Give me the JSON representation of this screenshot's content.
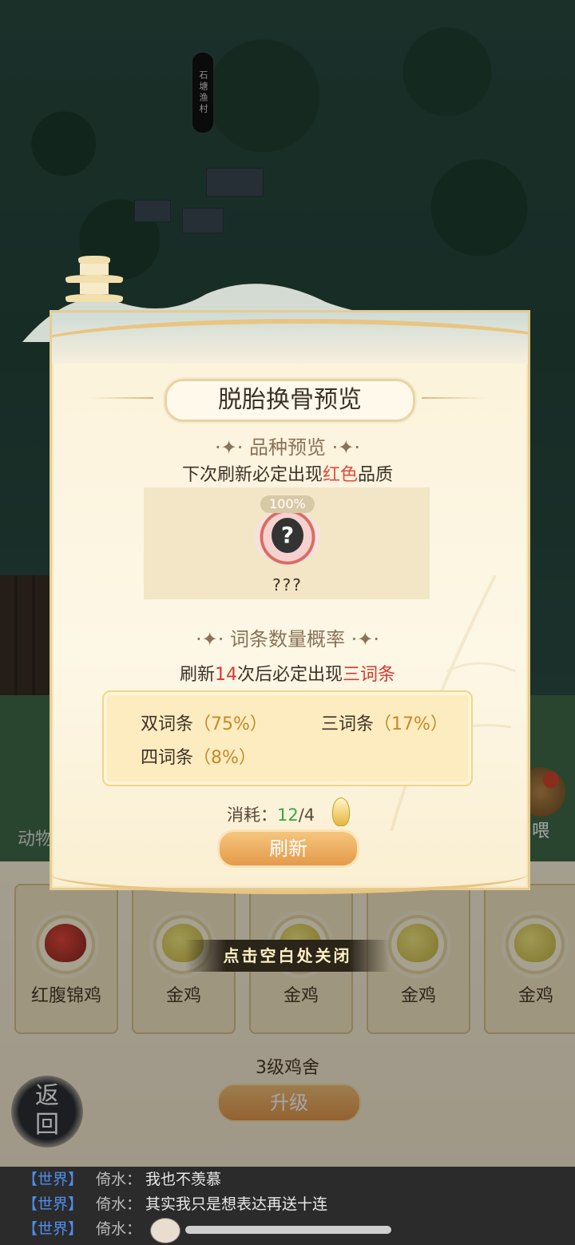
{
  "map": {
    "village_sign": "石塘渔村",
    "side_label": "动物",
    "right_label": "喂"
  },
  "coop": {
    "cards": [
      {
        "name": "红腹锦鸡",
        "variant": "red"
      },
      {
        "name": "金鸡",
        "variant": "gold"
      },
      {
        "name": "金鸡",
        "variant": "gold"
      },
      {
        "name": "金鸡",
        "variant": "gold"
      },
      {
        "name": "金鸡",
        "variant": "gold"
      }
    ],
    "level": "3级鸡舍",
    "upgrade_label": "升级",
    "back_label": "返回"
  },
  "dialog": {
    "title": "脱胎换骨预览",
    "breed_heading": "品种预览",
    "breed_desc_prefix": "下次刷新必定出现",
    "breed_desc_highlight": "红色",
    "breed_desc_suffix": "品质",
    "preview": {
      "percent": "100%",
      "name": "???"
    },
    "trait_heading": "词条数量概率",
    "trait_desc_prefix": "刷新",
    "trait_desc_count": "14",
    "trait_desc_mid": "次后必定出现",
    "trait_desc_highlight": "三词条",
    "probabilities": [
      {
        "label": "双词条",
        "value": "（75%）"
      },
      {
        "label": "三词条",
        "value": "（17%）"
      },
      {
        "label": "四词条",
        "value": "（8%）"
      }
    ],
    "cost_label": "消耗：",
    "cost_have": "12",
    "cost_need": "/4",
    "refresh_label": "刷新",
    "close_tip": "点击空白处关闭"
  },
  "chat": [
    {
      "channel": "【世界】",
      "sender": "倚水：",
      "message": "我也不羡慕"
    },
    {
      "channel": "【世界】",
      "sender": "倚水：",
      "message": "其实我只是想表达再送十连"
    },
    {
      "channel": "【世界】",
      "sender": "倚水：",
      "message": ""
    }
  ],
  "colors": {
    "highlight_red": "#e34a3f",
    "count_red": "#d63a2d",
    "percent_gold": "#c38a2a",
    "cost_green": "#37a74a",
    "chat_channel": "#4d8ef0"
  }
}
